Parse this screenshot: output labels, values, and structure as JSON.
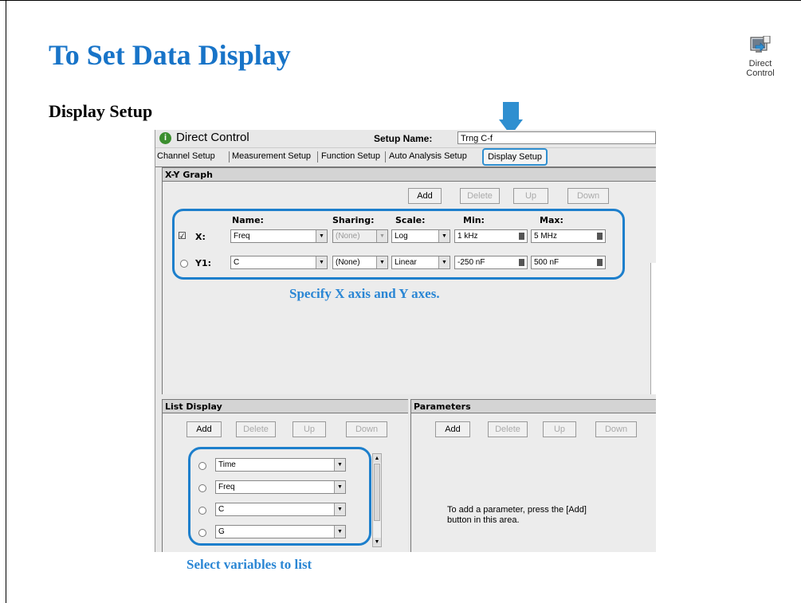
{
  "slide": {
    "title": "To Set Data Display",
    "subtitle": "Display Setup",
    "icon_label_1": "Direct",
    "icon_label_2": "Control",
    "icon": "direct-control-icon",
    "arrow_color": "#2f8fd0"
  },
  "app": {
    "window_title": "Direct Control",
    "setup_name_label": "Setup Name:",
    "setup_name_value": "Trng C-f",
    "tabs": [
      "Channel Setup",
      "Measurement Setup",
      "Function Setup",
      "Auto Analysis Setup",
      "Display Setup"
    ],
    "active_tab": "Display Setup"
  },
  "xy_graph": {
    "header": "X-Y Graph",
    "buttons": {
      "add": "Add",
      "delete": "Delete",
      "up": "Up",
      "down": "Down"
    },
    "columns": {
      "name": "Name:",
      "sharing": "Sharing:",
      "scale": "Scale:",
      "min": "Min:",
      "max": "Max:"
    },
    "rows": [
      {
        "label": "X:",
        "name": "Freq",
        "sharing": "(None)",
        "scale": "Log",
        "min": "1 kHz",
        "max": "5 MHz",
        "checked": true
      },
      {
        "label": "Y1:",
        "name": "C",
        "sharing": "(None)",
        "scale": "Linear",
        "min": "-250 nF",
        "max": "500 nF",
        "checked": false
      }
    ],
    "callout": "Specify X axis and Y axes."
  },
  "list_display": {
    "header": "List Display",
    "buttons": {
      "add": "Add",
      "delete": "Delete",
      "up": "Up",
      "down": "Down"
    },
    "items": [
      "Time",
      "Freq",
      "C",
      "G"
    ],
    "callout": "Select variables to list"
  },
  "parameters": {
    "header": "Parameters",
    "buttons": {
      "add": "Add",
      "delete": "Delete",
      "up": "Up",
      "down": "Down"
    },
    "hint_line1": "To add a parameter, press the [Add]",
    "hint_line2": "button in this area."
  },
  "colors": {
    "title": "#1874c8",
    "highlight": "#1d7fcc",
    "callout": "#2a86d4"
  }
}
